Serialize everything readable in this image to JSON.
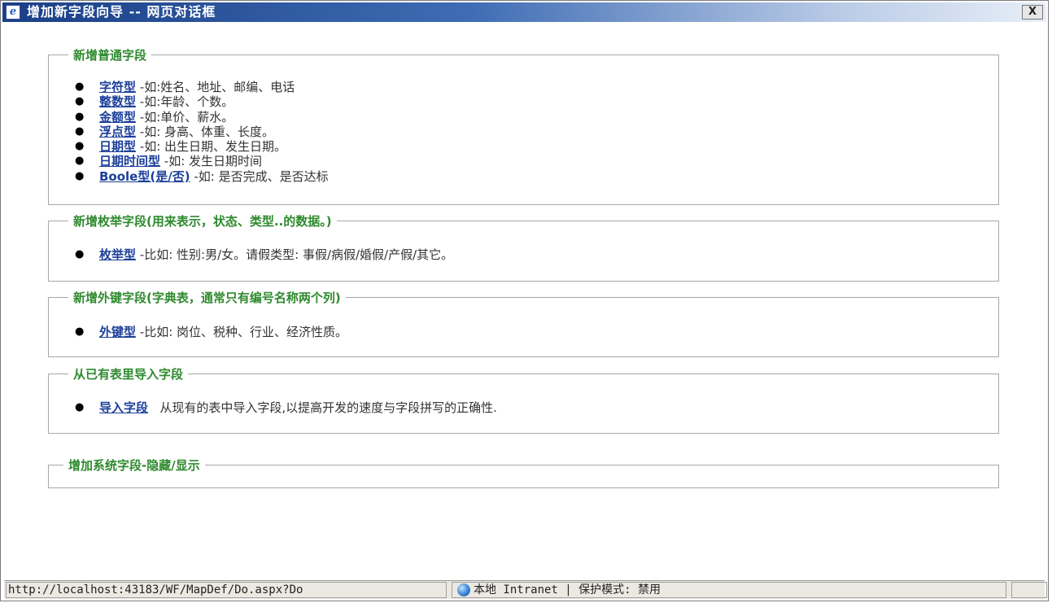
{
  "window": {
    "title": "增加新字段向导 -- 网页对话框",
    "close_label": "X",
    "icon": "ie-icon"
  },
  "sections": [
    {
      "legend": "新增普通字段",
      "items": [
        {
          "link": "字符型",
          "desc": " -如:姓名、地址、邮编、电话"
        },
        {
          "link": "整数型",
          "desc": " -如:年龄、个数。"
        },
        {
          "link": "金额型",
          "desc": " -如:单价、薪水。"
        },
        {
          "link": "浮点型",
          "desc": " -如: 身高、体重、长度。"
        },
        {
          "link": "日期型",
          "desc": " -如: 出生日期、发生日期。"
        },
        {
          "link": "日期时间型",
          "desc": " -如: 发生日期时间"
        },
        {
          "link": "Boole型(是/否)",
          "desc": " -如: 是否完成、是否达标"
        }
      ]
    },
    {
      "legend": "新增枚举字段(用来表示，状态、类型..的数据。)",
      "items": [
        {
          "link": "枚举型",
          "desc": " -比如: 性别:男/女。请假类型: 事假/病假/婚假/产假/其它。"
        }
      ]
    },
    {
      "legend": "新增外键字段(字典表，通常只有编号名称两个列)",
      "items": [
        {
          "link": "外键型",
          "desc": " -比如: 岗位、税种、行业、经济性质。"
        }
      ]
    },
    {
      "legend": "从已有表里导入字段",
      "items": [
        {
          "link": "导入字段",
          "desc": "   从现有的表中导入字段,以提高开发的速度与字段拼写的正确性."
        }
      ]
    },
    {
      "legend": "增加系统字段-隐藏/显示",
      "items": []
    }
  ],
  "statusbar": {
    "url": "http://localhost:43183/WF/MapDef/Do.aspx?Do",
    "zone": "本地 Intranet | 保护模式: 禁用",
    "zone_icon": "globe-icon"
  }
}
